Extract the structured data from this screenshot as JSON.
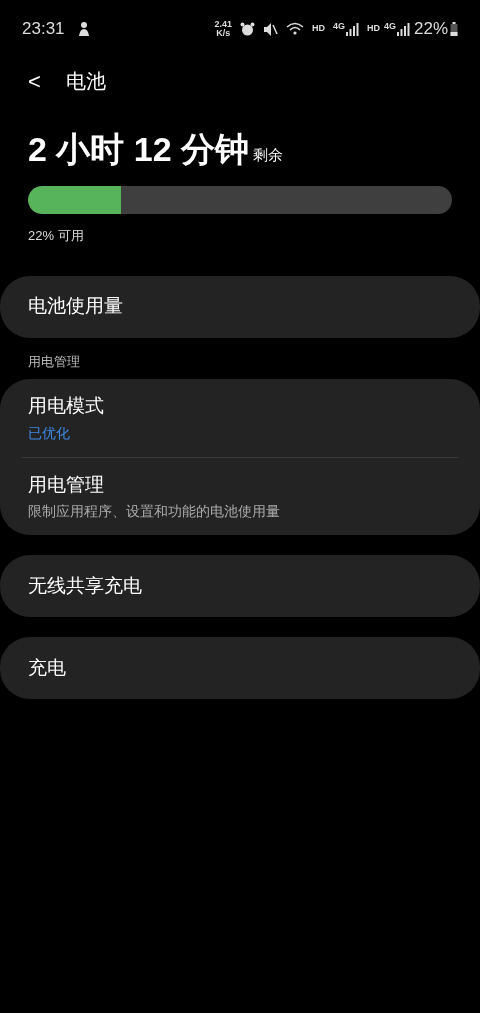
{
  "status_bar": {
    "time": "23:31",
    "speed_value": "2.41",
    "speed_unit": "K/s",
    "sim1_hd": "HD",
    "sim1_net": "4G",
    "sim2_hd": "HD",
    "sim2_net": "4G",
    "battery": "22%"
  },
  "header": {
    "back": "<",
    "title": "电池"
  },
  "summary": {
    "time_left": "2 小时 12 分钟",
    "suffix": "剩余",
    "level": 0.22,
    "available": "22% 可用"
  },
  "groups": [
    {
      "items": [
        {
          "title": "电池使用量"
        }
      ]
    },
    {
      "heading": "用电管理",
      "items": [
        {
          "title": "用电模式",
          "value": "已优化"
        },
        {
          "title": "用电管理",
          "subtitle": "限制应用程序、设置和功能的电池使用量"
        }
      ]
    },
    {
      "items": [
        {
          "title": "无线共享充电"
        }
      ]
    },
    {
      "items": [
        {
          "title": "充电"
        }
      ]
    }
  ]
}
